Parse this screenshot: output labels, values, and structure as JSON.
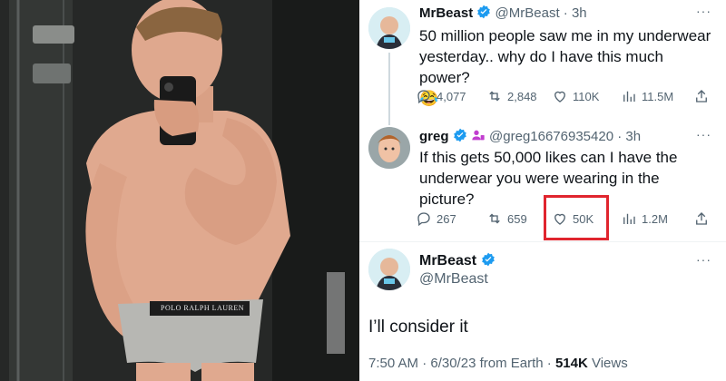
{
  "photo": {
    "alt_scene": "mirror-selfie"
  },
  "tweets": [
    {
      "name": "MrBeast",
      "handle": "@MrBeast",
      "dot": "·",
      "time": "3h",
      "text": "50 million people saw me in my underwear yesterday.. why do I have this much power?",
      "emoji": "😂",
      "replies": "4,077",
      "retweets": "2,848",
      "likes": "110K",
      "views": "11.5M"
    },
    {
      "name": "greg",
      "handle": "@greg16676935420",
      "dot": "·",
      "time": "3h",
      "text": "If this gets 50,000 likes can I have the underwear you were wearing in the picture?",
      "replies": "267",
      "retweets": "659",
      "likes": "50K",
      "views": "1.2M"
    },
    {
      "name": "MrBeast",
      "handle": "@MrBeast",
      "text": "I’ll consider it",
      "timestamp": "7:50 AM · 6/30/23 from Earth",
      "dot": "·",
      "views_count": "514K",
      "views_label": "Views"
    }
  ],
  "more_label": "···",
  "underwear_band_text": "POLO RALPH LAUREN",
  "colors": {
    "verified": "#1d9bf0",
    "highlight": "#e0252e",
    "affiliate": "#c13ecf"
  }
}
